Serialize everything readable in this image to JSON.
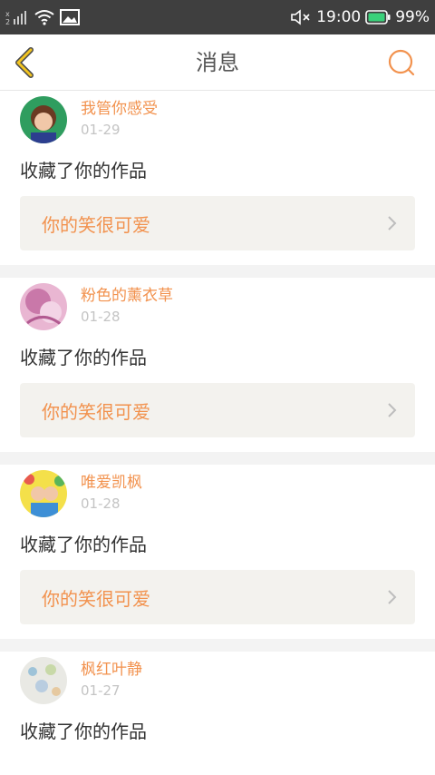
{
  "status_bar": {
    "time": "19:00",
    "battery": "99%"
  },
  "header": {
    "title": "消息"
  },
  "messages": [
    {
      "username": "我管你感受",
      "date": "01-29",
      "action": "收藏了你的作品",
      "work_title": "你的笑很可爱"
    },
    {
      "username": "粉色的薰衣草",
      "date": "01-28",
      "action": "收藏了你的作品",
      "work_title": "你的笑很可爱"
    },
    {
      "username": "唯爱凯枫",
      "date": "01-28",
      "action": "收藏了你的作品",
      "work_title": "你的笑很可爱"
    },
    {
      "username": "枫红叶静",
      "date": "01-27",
      "action": "收藏了你的作品",
      "work_title": ""
    }
  ],
  "colors": {
    "accent": "#f2924e",
    "back_arrow": "#f2c420",
    "card_bg": "#f3f2ee"
  }
}
